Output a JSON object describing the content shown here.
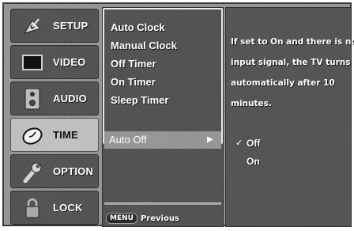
{
  "sidebar": {
    "items": [
      {
        "label": "SETUP",
        "icon": "satellite-dish-icon",
        "active": false
      },
      {
        "label": "VIDEO",
        "icon": "tv-screen-icon",
        "active": false
      },
      {
        "label": "AUDIO",
        "icon": "speaker-icon",
        "active": false
      },
      {
        "label": "TIME",
        "icon": "clock-icon",
        "active": true
      },
      {
        "label": "OPTION",
        "icon": "wrench-icon",
        "active": false
      },
      {
        "label": "LOCK",
        "icon": "padlock-icon",
        "active": false
      }
    ]
  },
  "submenu": {
    "items": [
      "Auto Clock",
      "Manual Clock",
      "Off Timer",
      "On Timer",
      "Sleep Timer"
    ],
    "selected": "Auto Off",
    "selected_arrow": "▶",
    "footer_key": "MENU",
    "footer_label": "Previous"
  },
  "help": {
    "lines": [
      "If set to On and there is no",
      "input signal, the TV turns off",
      "automatically after 10",
      "minutes."
    ],
    "check_mark": "✓",
    "options": [
      "Off",
      "On"
    ],
    "current": "Off"
  },
  "colors": {
    "panel_dark": "#555555",
    "panel_active": "#c0c0c0",
    "text": "#ffffff"
  }
}
